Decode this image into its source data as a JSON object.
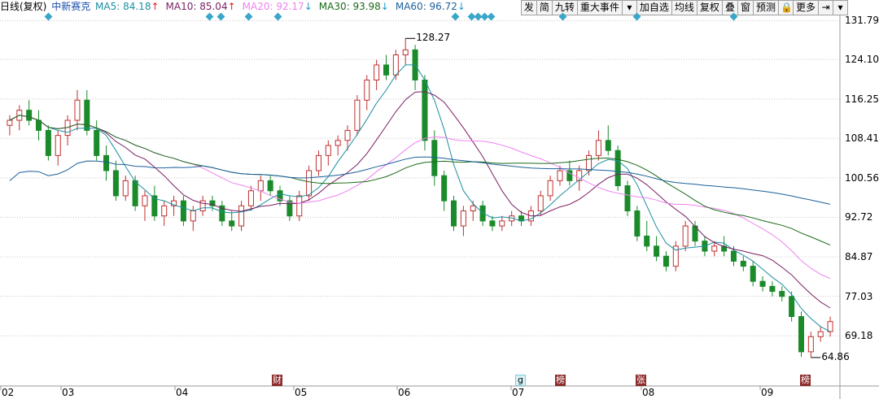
{
  "header": {
    "title": "日线(复权)",
    "stock": "中新赛克",
    "ma": [
      {
        "label": "MA5: 84.18",
        "arrow": "↑",
        "color": "#1b8fa0"
      },
      {
        "label": "MA10: 85.04",
        "arrow": "↑",
        "color": "#7a1f63"
      },
      {
        "label": "MA20: 92.17",
        "arrow": "↓",
        "color": "#ee82ee"
      },
      {
        "label": "MA30: 93.98",
        "arrow": "↓",
        "color": "#1a6a1a"
      },
      {
        "label": "MA60: 96.72",
        "arrow": "↓",
        "color": "#1b5f9a"
      }
    ]
  },
  "toolbar": {
    "buttons": [
      "发",
      "简",
      "九转",
      "重大事件",
      "加自选",
      "均线",
      "复权",
      "叠",
      "窗",
      "预测",
      "更多"
    ],
    "icons": [
      "dropdown-icon",
      "lock-icon",
      "pin-icon",
      "dropdown-icon"
    ]
  },
  "events": [
    "财",
    "g",
    "榜",
    "张",
    "榜"
  ],
  "chart_data": {
    "type": "candlestick",
    "ylim": [
      61.3,
      133.0
    ],
    "y_ticks": [
      "131.79",
      "124.10",
      "116.25",
      "108.41",
      "100.56",
      "92.72",
      "84.87",
      "77.03",
      "69.18"
    ],
    "x_tick_labels": [
      "02",
      "03",
      "04",
      "05",
      "06",
      "07",
      "08",
      "09"
    ],
    "annotations": [
      {
        "label": "128.27",
        "value": 128.27
      },
      {
        "label": "64.86",
        "value": 64.86
      }
    ],
    "series": [
      {
        "name": "MA5",
        "color": "#1b8fa0"
      },
      {
        "name": "MA10",
        "color": "#7a1f63"
      },
      {
        "name": "MA20",
        "color": "#ee82ee"
      },
      {
        "name": "MA30",
        "color": "#1a6a1a"
      },
      {
        "name": "MA60",
        "color": "#1b5f9a"
      }
    ],
    "candles": [
      [
        111,
        113,
        109,
        112
      ],
      [
        112,
        115,
        110,
        114
      ],
      [
        114,
        116,
        111,
        112
      ],
      [
        112,
        114,
        108,
        110
      ],
      [
        110,
        111,
        104,
        105
      ],
      [
        105,
        110,
        103,
        109
      ],
      [
        109,
        113,
        107,
        112
      ],
      [
        112,
        118,
        110,
        116
      ],
      [
        116,
        118,
        109,
        110
      ],
      [
        110,
        112,
        104,
        105
      ],
      [
        105,
        107,
        100,
        102
      ],
      [
        102,
        104,
        96,
        97
      ],
      [
        97,
        101,
        96,
        100
      ],
      [
        100,
        101,
        94,
        95
      ],
      [
        95,
        98,
        92,
        97
      ],
      [
        97,
        99,
        92,
        93
      ],
      [
        93,
        96,
        91,
        95
      ],
      [
        95,
        97,
        93,
        96
      ],
      [
        96,
        97,
        91,
        92
      ],
      [
        92,
        95,
        90,
        94
      ],
      [
        94,
        97,
        93,
        96
      ],
      [
        96,
        97,
        94,
        95
      ],
      [
        95,
        96,
        91,
        92
      ],
      [
        92,
        94,
        90,
        91
      ],
      [
        91,
        96,
        90,
        95
      ],
      [
        95,
        99,
        94,
        98
      ],
      [
        98,
        101,
        96,
        100
      ],
      [
        100,
        101,
        97,
        98
      ],
      [
        98,
        99,
        95,
        96
      ],
      [
        96,
        97,
        92,
        93
      ],
      [
        93,
        98,
        92,
        97
      ],
      [
        97,
        103,
        96,
        102
      ],
      [
        102,
        106,
        101,
        105
      ],
      [
        105,
        108,
        103,
        107
      ],
      [
        107,
        109,
        105,
        108
      ],
      [
        108,
        111,
        106,
        110
      ],
      [
        110,
        117,
        109,
        116
      ],
      [
        116,
        121,
        114,
        120
      ],
      [
        120,
        124,
        118,
        123
      ],
      [
        123,
        125,
        120,
        121
      ],
      [
        121,
        126,
        120,
        125
      ],
      [
        125,
        128.27,
        123,
        126
      ],
      [
        126,
        127,
        118,
        120
      ],
      [
        120,
        121,
        106,
        108
      ],
      [
        108,
        110,
        99,
        101
      ],
      [
        101,
        102,
        94,
        96
      ],
      [
        96,
        97,
        90,
        91
      ],
      [
        91,
        95,
        89,
        94
      ],
      [
        94,
        96,
        92,
        95
      ],
      [
        95,
        96,
        91,
        92
      ],
      [
        92,
        93,
        90,
        91
      ],
      [
        91,
        93,
        90,
        92
      ],
      [
        92,
        94,
        91,
        93
      ],
      [
        93,
        94,
        91,
        92
      ],
      [
        92,
        95,
        91,
        94
      ],
      [
        94,
        98,
        93,
        97
      ],
      [
        97,
        101,
        96,
        100
      ],
      [
        100,
        103,
        99,
        102
      ],
      [
        102,
        104,
        99,
        100
      ],
      [
        100,
        103,
        98,
        102
      ],
      [
        102,
        106,
        101,
        105
      ],
      [
        105,
        110,
        104,
        108
      ],
      [
        108,
        111,
        105,
        106
      ],
      [
        106,
        107,
        98,
        99
      ],
      [
        99,
        100,
        93,
        94
      ],
      [
        94,
        95,
        88,
        89
      ],
      [
        89,
        92,
        86,
        87
      ],
      [
        87,
        89,
        84,
        85
      ],
      [
        85,
        86,
        82,
        83
      ],
      [
        83,
        88,
        82,
        87
      ],
      [
        87,
        92,
        86,
        91
      ],
      [
        91,
        92,
        87,
        88
      ],
      [
        88,
        89,
        85,
        86
      ],
      [
        86,
        88,
        85,
        87
      ],
      [
        87,
        89,
        85,
        86
      ],
      [
        86,
        87,
        83,
        84
      ],
      [
        84,
        85,
        82,
        83
      ],
      [
        83,
        84,
        79,
        80
      ],
      [
        80,
        81,
        78,
        79
      ],
      [
        79,
        80,
        77,
        78
      ],
      [
        78,
        79,
        76,
        77
      ],
      [
        77,
        78,
        72,
        73
      ],
      [
        73,
        74,
        65,
        66
      ],
      [
        66,
        70,
        64.86,
        69
      ],
      [
        69,
        71,
        68,
        70
      ],
      [
        70,
        73,
        69,
        72
      ]
    ]
  }
}
